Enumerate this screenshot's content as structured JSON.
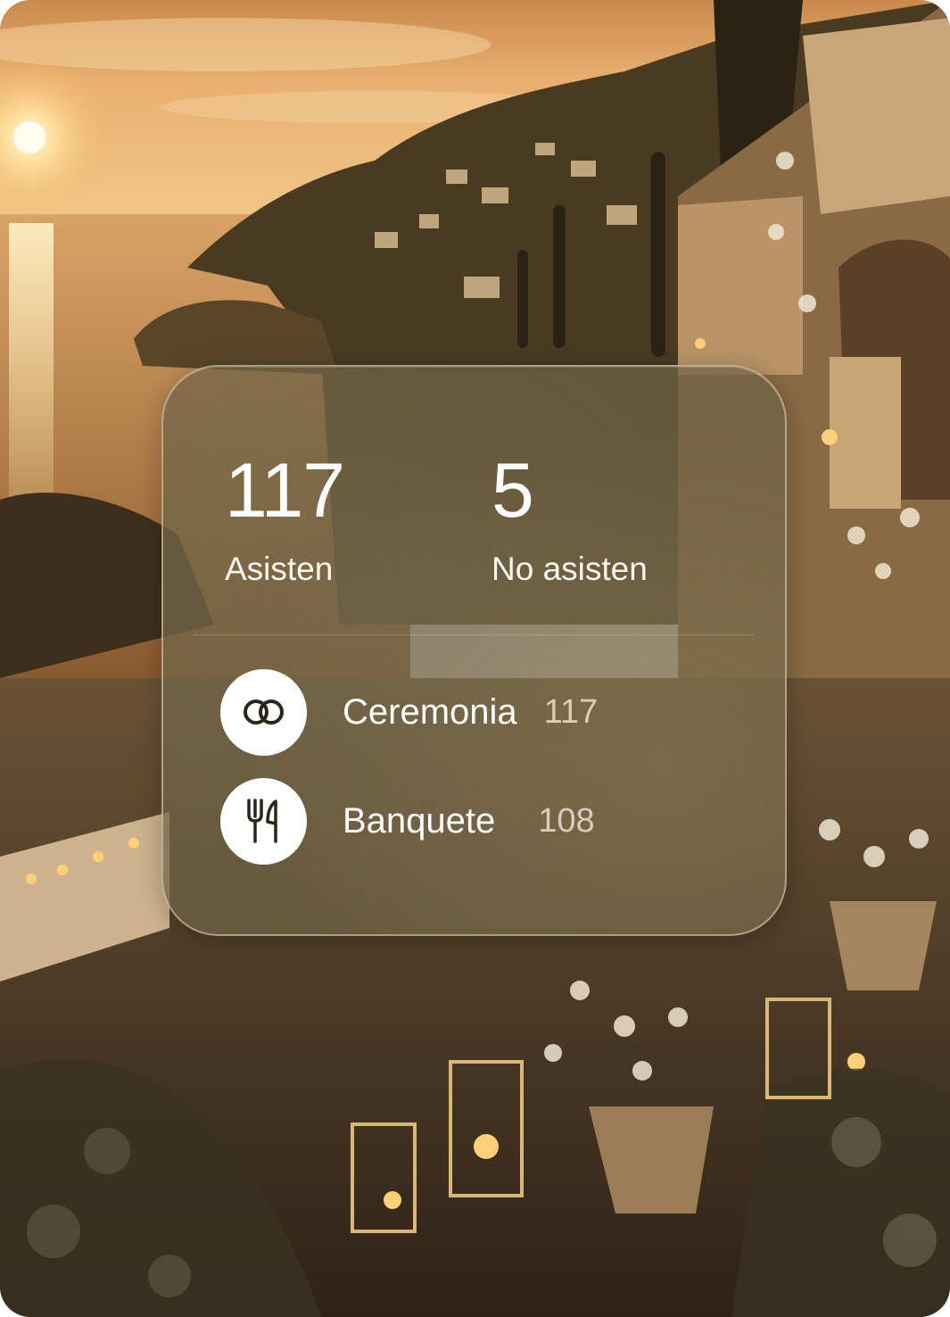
{
  "summary": {
    "attending": {
      "value": "117",
      "label": "Asisten"
    },
    "not_attending": {
      "value": "5",
      "label": "No asisten"
    }
  },
  "events": [
    {
      "icon": "wedding-rings-icon",
      "label": "Ceremonia",
      "count": "117"
    },
    {
      "icon": "fork-knife-icon",
      "label": "Banquete",
      "count": "108"
    }
  ],
  "colors": {
    "panel": "#70624a",
    "text": "#ffffff",
    "muted_count": "#e6ddd0",
    "icon_bg": "#ffffff",
    "icon_fg": "#2b2418"
  }
}
